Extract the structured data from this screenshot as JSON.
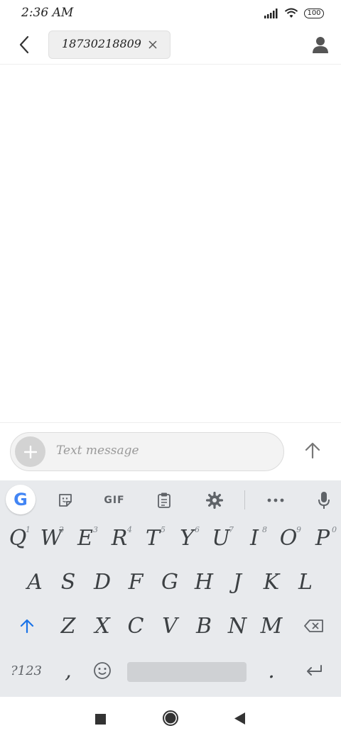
{
  "status_bar": {
    "time": "2:36 AM",
    "battery": "100"
  },
  "header": {
    "recipient": "18730218809"
  },
  "composer": {
    "placeholder": "Text message"
  },
  "keyboard": {
    "toolbar": {
      "google_label": "G",
      "gif_label": "GIF"
    },
    "rows": {
      "row1": [
        "Q",
        "W",
        "E",
        "R",
        "T",
        "Y",
        "U",
        "I",
        "O",
        "P"
      ],
      "row1_hints": [
        "1",
        "2",
        "3",
        "4",
        "5",
        "6",
        "7",
        "8",
        "9",
        "0"
      ],
      "row2": [
        "A",
        "S",
        "D",
        "F",
        "G",
        "H",
        "J",
        "K",
        "L"
      ],
      "row3": [
        "Z",
        "X",
        "C",
        "V",
        "B",
        "N",
        "M"
      ]
    },
    "symbols_key": "?123",
    "comma": ",",
    "period": "."
  }
}
